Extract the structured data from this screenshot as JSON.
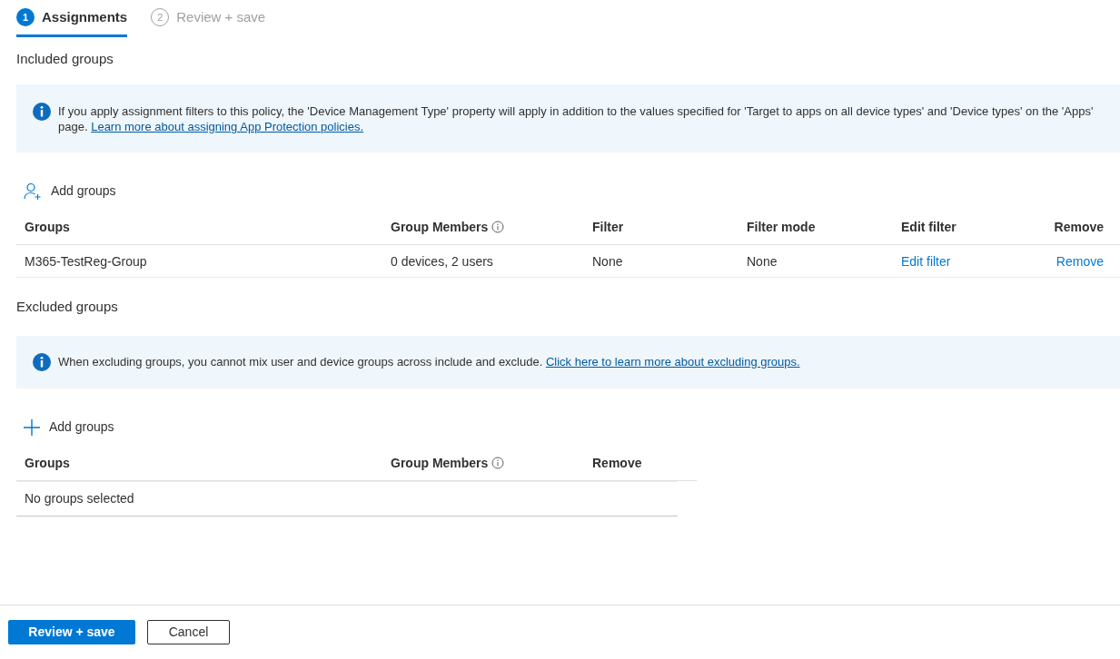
{
  "steps": [
    {
      "number": "1",
      "label": "Assignments",
      "selected": true
    },
    {
      "number": "2",
      "label": "Review + save",
      "selected": false
    }
  ],
  "sections": [
    {
      "title": "Included groups",
      "info": {
        "text": "If you apply assignment filters to this policy, the 'Device Management Type' property will apply in addition to the values specified for 'Target to apps on all device types' and 'Device types' on the 'Apps' page.",
        "link": "Learn more about assigning App Protection policies."
      },
      "add_button": {
        "kind": "person",
        "label": "Add groups"
      },
      "table": {
        "kind": "full",
        "columns": [
          {
            "label": "Groups",
            "info": false
          },
          {
            "label": "Group Members",
            "info": true
          },
          {
            "label": "Filter",
            "info": false
          },
          {
            "label": "Filter mode",
            "info": false
          },
          {
            "label": "Edit filter",
            "info": false
          },
          {
            "label": "Remove",
            "info": false
          }
        ],
        "rows": [
          [
            {
              "kind": "text",
              "text": "M365-TestReg-Group"
            },
            {
              "kind": "text",
              "text": "0 devices, 2 users"
            },
            {
              "kind": "text",
              "text": "None"
            },
            {
              "kind": "text",
              "text": "None"
            },
            {
              "kind": "link",
              "text": "Edit filter"
            },
            {
              "kind": "link",
              "text": "Remove"
            }
          ]
        ]
      }
    },
    {
      "title": "Excluded groups",
      "info": {
        "text": "When excluding groups, you cannot mix user and device groups across include and exclude.",
        "link": "Click here to learn more about excluding groups."
      },
      "add_button": {
        "kind": "plus",
        "label": "Add groups"
      },
      "table": {
        "kind": "compact",
        "columns": [
          {
            "label": "Groups",
            "info": false
          },
          {
            "label": "Group Members",
            "info": true
          },
          {
            "label": "Remove",
            "info": false
          }
        ],
        "empty_message": "No groups selected"
      }
    }
  ],
  "footer": {
    "buttons": [
      {
        "label": "Review + save",
        "primary": true
      },
      {
        "label": "Cancel",
        "primary": false
      }
    ]
  }
}
